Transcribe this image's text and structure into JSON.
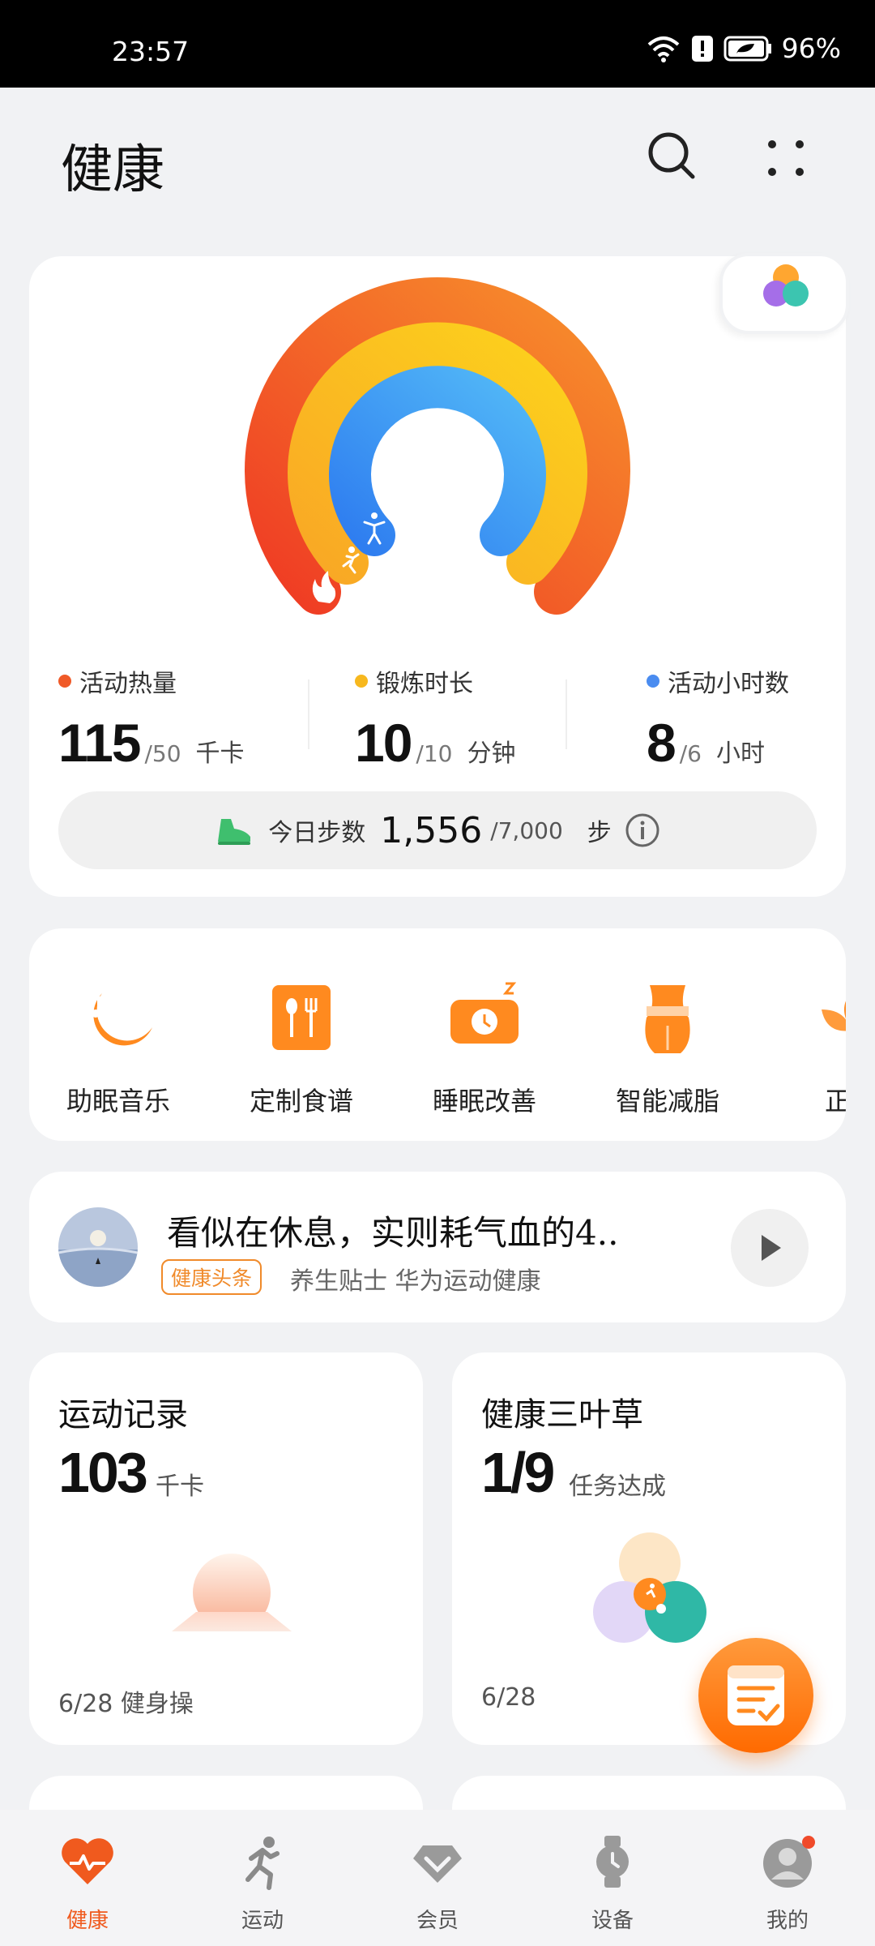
{
  "status_bar": {
    "time": "23:57",
    "battery": "96%"
  },
  "header": {
    "title": "健康"
  },
  "activity": {
    "metrics": [
      {
        "label": "活动热量",
        "value": "115",
        "goal": "/50",
        "unit": "千卡",
        "color": "#f05a28"
      },
      {
        "label": "锻炼时长",
        "value": "10",
        "goal": "/10",
        "unit": "分钟",
        "color": "#f7b81e"
      },
      {
        "label": "活动小时数",
        "value": "8",
        "goal": "/6",
        "unit": "小时",
        "color": "#4a8cf0"
      }
    ],
    "steps": {
      "label": "今日步数",
      "value": "1,556",
      "goal": "/7,000",
      "unit": "步"
    }
  },
  "services": [
    {
      "label": "助眠音乐",
      "icon": "sleep-music-icon"
    },
    {
      "label": "定制食谱",
      "icon": "recipe-icon"
    },
    {
      "label": "睡眠改善",
      "icon": "sleep-improve-icon"
    },
    {
      "label": "智能减脂",
      "icon": "fat-loss-icon"
    },
    {
      "label": "正念",
      "icon": "mindfulness-icon"
    }
  ],
  "news": {
    "title": "看似在休息，实则耗气血的4..",
    "tag": "健康头条",
    "source": "养生贴士  华为运动健康"
  },
  "record_tile": {
    "title": "运动记录",
    "value": "103",
    "unit": "千卡",
    "footer": "6/28  健身操"
  },
  "clover_tile": {
    "title": "健康三叶草",
    "value": "1/9",
    "unit": "任务达成",
    "footer": "6/28"
  },
  "nav": [
    {
      "label": "健康",
      "icon": "heart-pulse-icon",
      "active": true
    },
    {
      "label": "运动",
      "icon": "running-icon",
      "active": false
    },
    {
      "label": "会员",
      "icon": "diamond-icon",
      "active": false
    },
    {
      "label": "设备",
      "icon": "watch-icon",
      "active": false
    },
    {
      "label": "我的",
      "icon": "profile-icon",
      "active": false
    }
  ],
  "colors": {
    "accent": "#f05a1e",
    "calories": "#f05a28",
    "exercise": "#f7b81e",
    "hours": "#4a8cf0"
  }
}
